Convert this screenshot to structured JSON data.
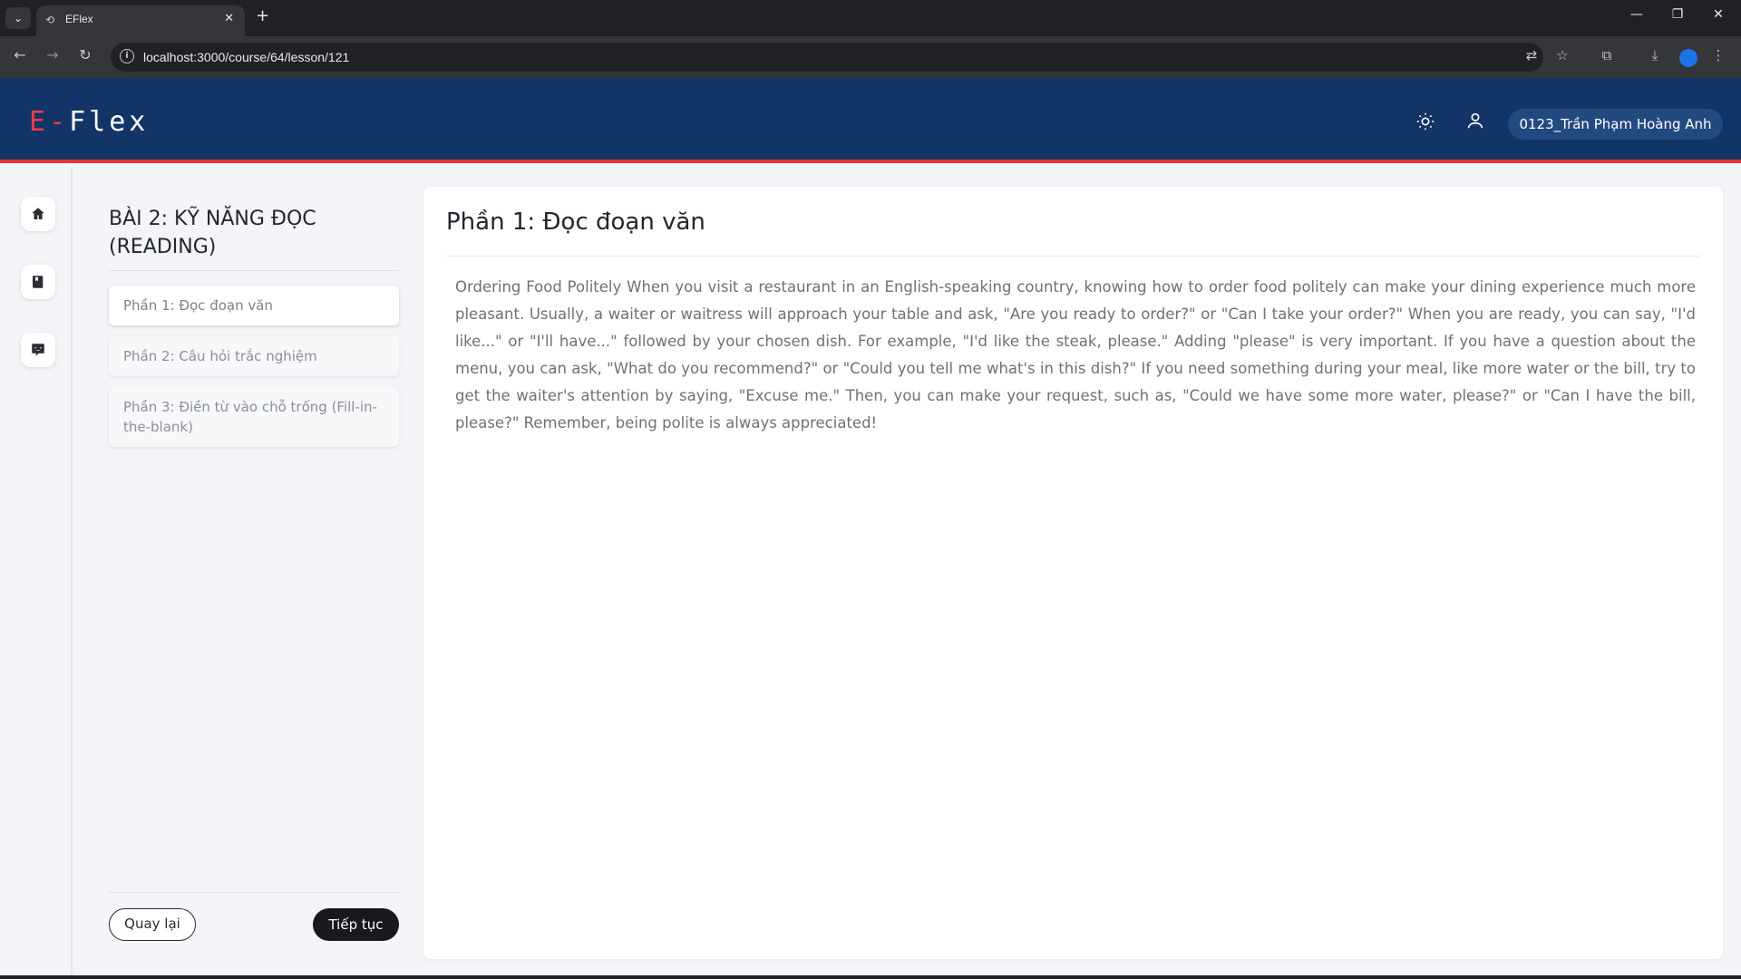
{
  "browser": {
    "tab_title": "EFlex",
    "url": "localhost:3000/course/64/lesson/121"
  },
  "header": {
    "logo_prefix": "E-",
    "logo_suffix": "Flex",
    "user_name": "0123_Trần Phạm Hoàng Anh"
  },
  "rail": {
    "items": [
      "home-icon",
      "book-icon",
      "chat-icon"
    ]
  },
  "lesson": {
    "title": "BÀI 2: KỸ NĂNG ĐỌC (READING)",
    "parts": [
      {
        "label": "Phần 1: Đọc đoạn văn"
      },
      {
        "label": "Phần 2: Câu hỏi trắc nghiệm"
      },
      {
        "label": "Phần 3: Điền từ vào chỗ trống (Fill-in-the-blank)"
      }
    ],
    "active_part": 0,
    "back_label": "Quay lại",
    "next_label": "Tiếp tục"
  },
  "content": {
    "title": "Phần 1: Đọc đoạn văn",
    "text": "Ordering Food Politely When you visit a restaurant in an English-speaking country, knowing how to order food politely can make your dining experience much more pleasant. Usually, a waiter or waitress will approach your table and ask, \"Are you ready to order?\" or \"Can I take your order?\" When you are ready, you can say, \"I'd like...\" or \"I'll have...\" followed by your chosen dish. For example, \"I'd like the steak, please.\" Adding \"please\" is very important. If you have a question about the menu, you can ask, \"What do you recommend?\" or \"Could you tell me what's in this dish?\" If you need something during your meal, like more water or the bill, try to get the waiter's attention by saying, \"Excuse me.\" Then, you can make your request, such as, \"Could we have some more water, please?\" or \"Can I have the bill, please?\" Remember, being polite is always appreciated!"
  },
  "colors": {
    "header_bg": "#123466",
    "header_accent": "#e8333a",
    "logo_accent": "#ef3b46",
    "primary_button": "#17191e"
  }
}
